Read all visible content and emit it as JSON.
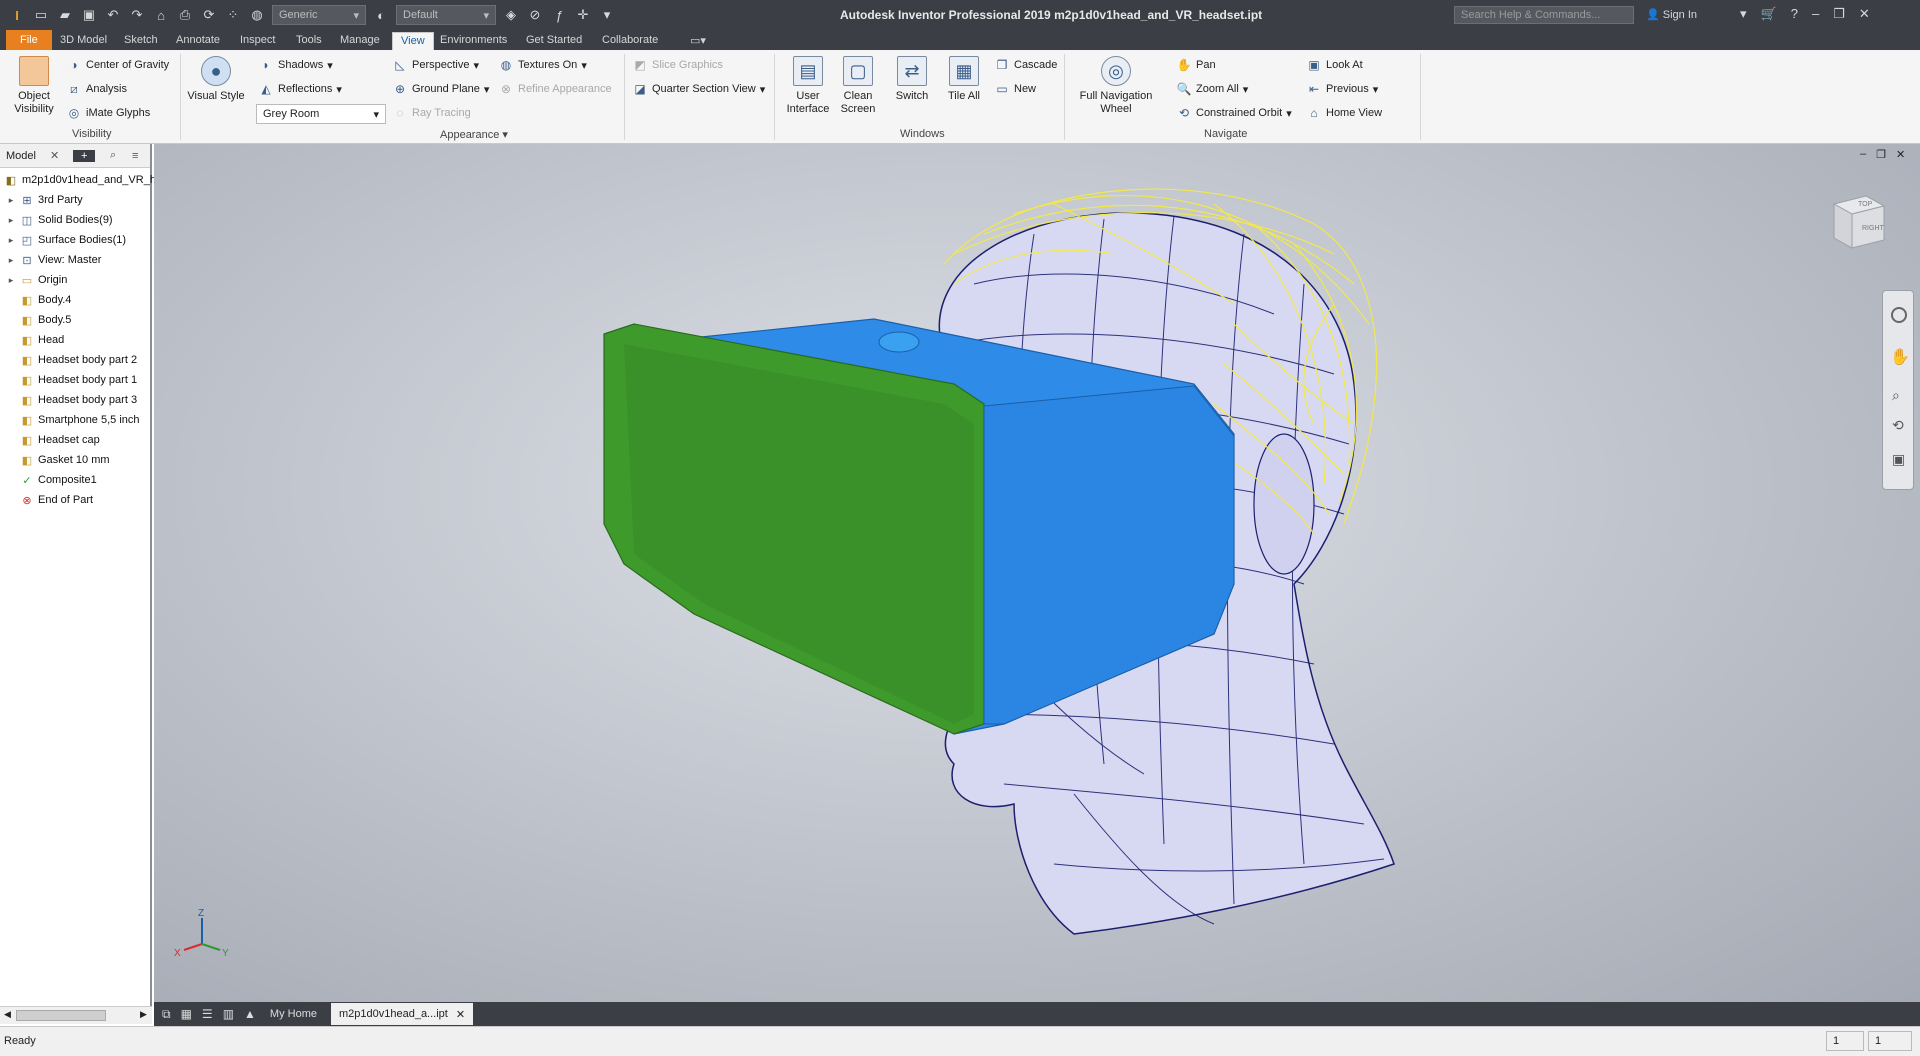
{
  "titlebar": {
    "title": "Autodesk Inventor Professional 2019   m2p1d0v1head_and_VR_headset.ipt",
    "material_combo": "Generic",
    "appearance_combo": "Default",
    "search_placeholder": "Search Help & Commands...",
    "signin": "Sign In"
  },
  "tabs": [
    "File",
    "3D Model",
    "Sketch",
    "Annotate",
    "Inspect",
    "Tools",
    "Manage",
    "View",
    "Environments",
    "Get Started",
    "Collaborate"
  ],
  "active_tab": "View",
  "ribbon": {
    "visibility": {
      "label": "Visibility",
      "object_visibility_line1": "Object",
      "object_visibility_line2": "Visibility",
      "center_of_gravity": "Center of Gravity",
      "analysis": "Analysis",
      "imate_glyphs": "iMate Glyphs"
    },
    "appearance": {
      "label": "Appearance",
      "visual_style": "Visual Style",
      "shadows": "Shadows",
      "reflections": "Reflections",
      "lighting_combo": "Grey Room",
      "perspective": "Perspective",
      "ground_plane": "Ground Plane",
      "ray_tracing": "Ray Tracing",
      "textures_on": "Textures On",
      "refine_appearance": "Refine Appearance",
      "slice_graphics": "Slice Graphics",
      "quarter_section_view": "Quarter Section View"
    },
    "windows": {
      "label": "Windows",
      "user_interface_line1": "User",
      "user_interface_line2": "Interface",
      "clean_screen_line1": "Clean",
      "clean_screen_line2": "Screen",
      "switch": "Switch",
      "tile_all": "Tile All",
      "cascade": "Cascade",
      "new": "New"
    },
    "navigate": {
      "label": "Navigate",
      "full_nav_line1": "Full Navigation",
      "full_nav_line2": "Wheel",
      "pan": "Pan",
      "zoom_all": "Zoom All",
      "constrained_orbit": "Constrained Orbit",
      "look_at": "Look At",
      "previous": "Previous",
      "home_view": "Home View"
    }
  },
  "browser": {
    "tab_label": "Model",
    "root": "m2p1d0v1head_and_VR_h",
    "items": [
      {
        "label": "3rd Party",
        "expandable": true,
        "icon": "third-party-icon"
      },
      {
        "label": "Solid Bodies(9)",
        "expandable": true,
        "icon": "solid-bodies-icon"
      },
      {
        "label": "Surface Bodies(1)",
        "expandable": true,
        "icon": "surface-bodies-icon"
      },
      {
        "label": "View: Master",
        "expandable": true,
        "icon": "view-icon"
      },
      {
        "label": "Origin",
        "expandable": true,
        "icon": "folder-icon"
      },
      {
        "label": "Body.4",
        "expandable": false,
        "icon": "body-icon"
      },
      {
        "label": "Body.5",
        "expandable": false,
        "icon": "body-icon"
      },
      {
        "label": "Head",
        "expandable": false,
        "icon": "body-icon"
      },
      {
        "label": "Headset body part 2",
        "expandable": false,
        "icon": "body-icon"
      },
      {
        "label": "Headset body part 1",
        "expandable": false,
        "icon": "body-icon"
      },
      {
        "label": "Headset body part 3",
        "expandable": false,
        "icon": "body-icon"
      },
      {
        "label": "Smartphone 5,5 inch",
        "expandable": false,
        "icon": "body-icon"
      },
      {
        "label": "Headset cap",
        "expandable": false,
        "icon": "body-icon"
      },
      {
        "label": "Gasket 10 mm",
        "expandable": false,
        "icon": "body-icon"
      },
      {
        "label": "Composite1",
        "expandable": false,
        "icon": "composite-icon"
      },
      {
        "label": "End of Part",
        "expandable": false,
        "icon": "end-of-part-icon"
      }
    ]
  },
  "viewcube": {
    "top_label": "TOP",
    "right_label": "RIGHT"
  },
  "triad": {
    "x": "X",
    "y": "Y",
    "z": "Z"
  },
  "doc_tabs": {
    "home": "My Home",
    "document": "m2p1d0v1head_a...ipt"
  },
  "status": {
    "text": "Ready",
    "count1": "1",
    "count2": "1"
  },
  "colors": {
    "accent": "#1a5fa8",
    "file_tab": "#e8801f",
    "headset_blue": "#2f8be8",
    "headset_green": "#3f9a2c",
    "wire_yellow": "#f2e84a",
    "mesh_navy": "#1b1f6e"
  }
}
